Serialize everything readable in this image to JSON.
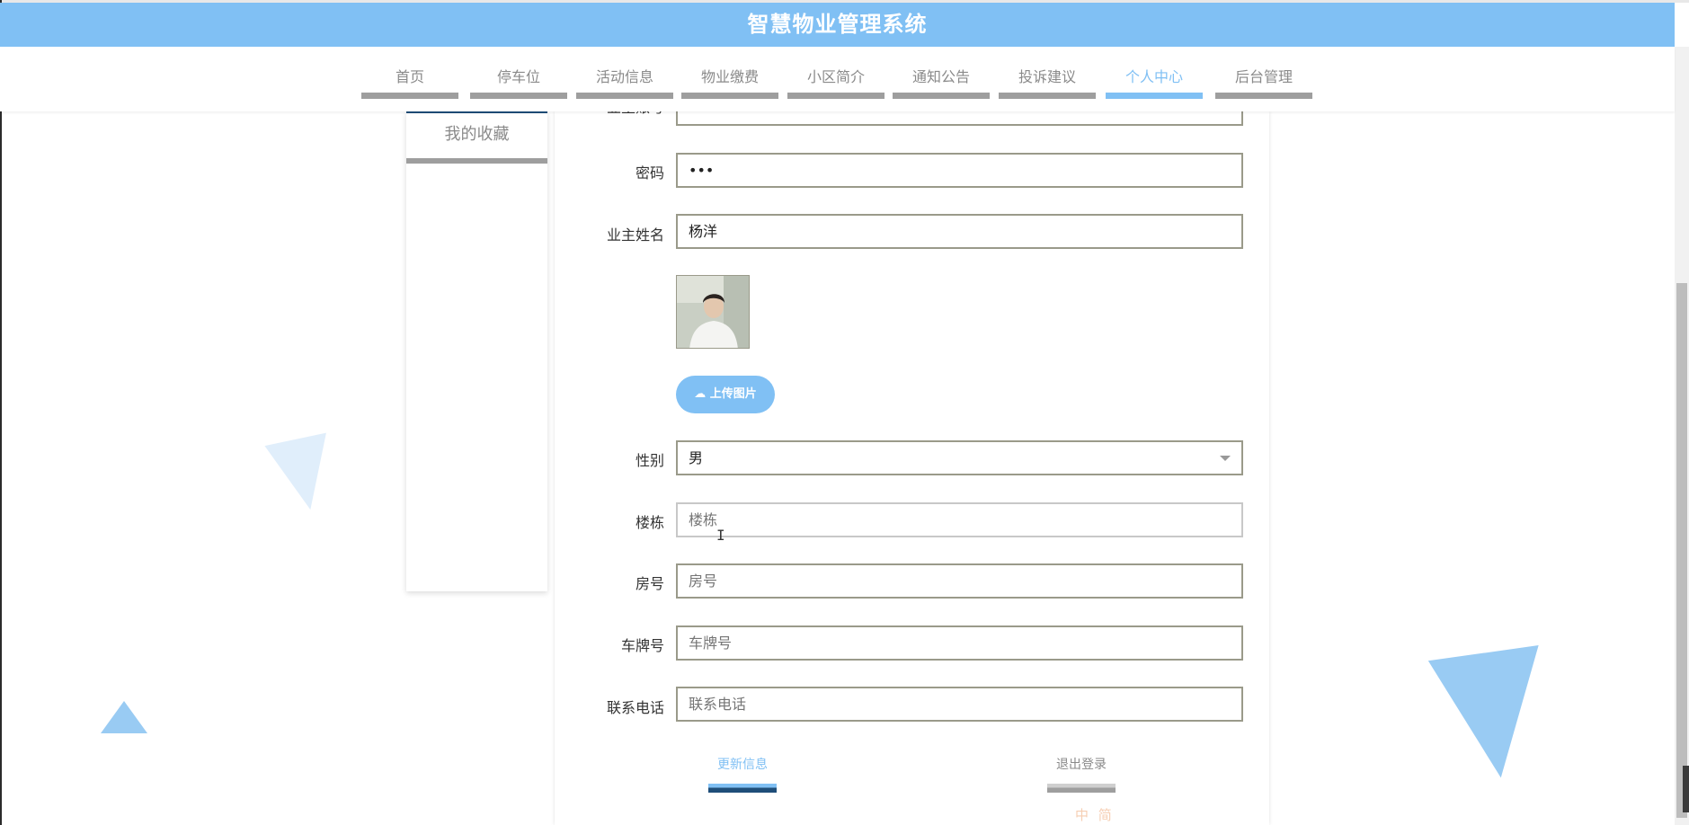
{
  "app": {
    "title": "智慧物业管理系统"
  },
  "nav": {
    "items": [
      {
        "label": "首页"
      },
      {
        "label": "停车位"
      },
      {
        "label": "活动信息"
      },
      {
        "label": "物业缴费"
      },
      {
        "label": "小区简介"
      },
      {
        "label": "通知公告"
      },
      {
        "label": "投诉建议"
      },
      {
        "label": "个人中心"
      },
      {
        "label": "后台管理"
      }
    ],
    "active_index": 7
  },
  "sidebar": {
    "items": [
      {
        "label": "我的收藏"
      }
    ]
  },
  "form": {
    "account": {
      "label": "业主账号",
      "value": "•••"
    },
    "password": {
      "label": "密码",
      "value": "•••"
    },
    "owner_name": {
      "label": "业主姓名",
      "value": "杨洋"
    },
    "avatar": {
      "alt": "avatar-photo"
    },
    "upload_label": "上传图片",
    "gender": {
      "label": "性别",
      "value": "男"
    },
    "building": {
      "label": "楼栋",
      "placeholder": "楼栋"
    },
    "room": {
      "label": "房号",
      "placeholder": "房号"
    },
    "plate": {
      "label": "车牌号",
      "placeholder": "车牌号"
    },
    "phone": {
      "label": "联系电话",
      "placeholder": "联系电话"
    }
  },
  "actions": {
    "update_label": "更新信息",
    "logout_label": "退出登录"
  },
  "ime_toolbar": "中 简",
  "colors": {
    "brand": "#80c0f4",
    "nav_inactive": "#9e9e9e",
    "dark_blue": "#1f4e79",
    "triangle_light": "#e0eefb",
    "triangle": "#99cbf3"
  }
}
